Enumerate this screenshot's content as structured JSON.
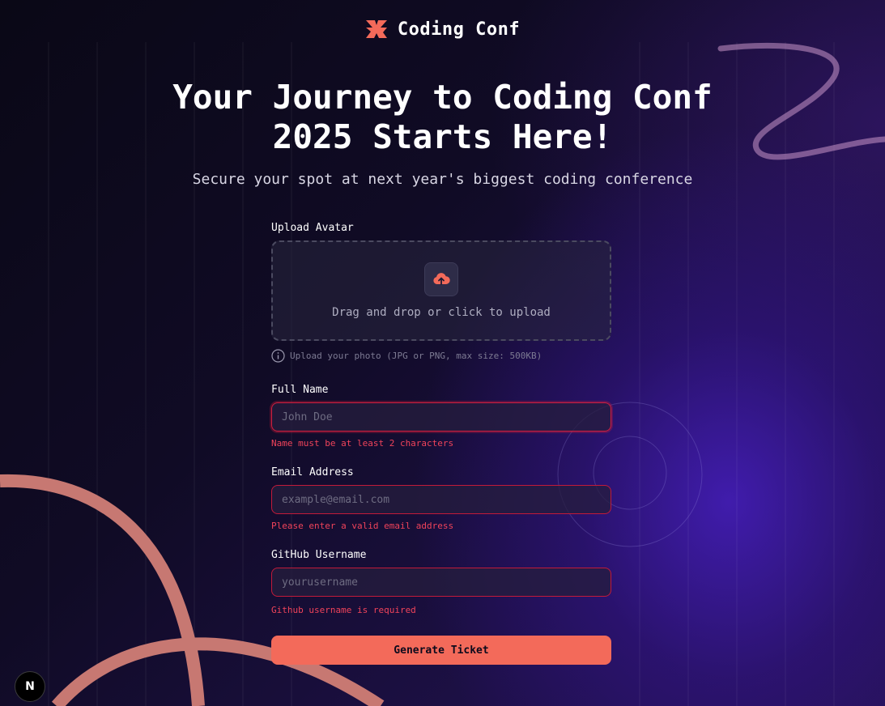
{
  "brand": {
    "name": "Coding Conf",
    "accent_color": "#f36a5a",
    "logo_icon": "coding-conf-logo"
  },
  "hero": {
    "title": "Your Journey to Coding Conf 2025 Starts Here!",
    "subtitle": "Secure your spot at next year's biggest coding conference"
  },
  "form": {
    "avatar": {
      "label": "Upload Avatar",
      "dropzone_text": "Drag and drop or click to upload",
      "hint": "Upload your photo (JPG or PNG, max size: 500KB)",
      "icon": "upload-cloud-icon"
    },
    "full_name": {
      "label": "Full Name",
      "placeholder": "John Doe",
      "value": "",
      "error": "Name must be at least 2 characters"
    },
    "email": {
      "label": "Email Address",
      "placeholder": "example@email.com",
      "value": "",
      "error": "Please enter a valid email address"
    },
    "github": {
      "label": "GitHub Username",
      "placeholder": "yourusername",
      "value": "",
      "error": "Github username is required"
    },
    "submit_label": "Generate Ticket",
    "error_color": "#f0435a"
  },
  "dev_badge": {
    "label": "N",
    "icon": "nextjs-icon"
  }
}
